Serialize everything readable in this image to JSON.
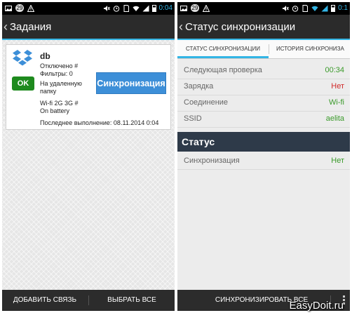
{
  "left": {
    "statusbar": {
      "notif_count": "29",
      "time": "0:04"
    },
    "actionbar": {
      "title": "Задания"
    },
    "card": {
      "name": "db",
      "status_lines": [
        "Отключено #",
        "Фильтры: 0",
        "На удаленную",
        "папку",
        "Wi-fi 2G 3G #",
        "On battery"
      ],
      "last_run": "Последнее выполнение: 08.11.2014 0:04",
      "ok_label": "OK",
      "sync_button": "Синхронизация"
    },
    "bottombar": {
      "add_link": "ДОБАВИТЬ СВЯЗЬ",
      "select_all": "ВЫБРАТЬ ВСЕ"
    }
  },
  "right": {
    "statusbar": {
      "notif_count": "29",
      "time": "0:1"
    },
    "actionbar": {
      "title": "Статус синхронизации"
    },
    "tabs": [
      "СТАТУС СИНХРОНИЗАЦИИ",
      "ИСТОРИЯ СИНХРОНИЗА"
    ],
    "info": [
      {
        "label": "Следующая проверка",
        "value": "00:34",
        "color": "green"
      },
      {
        "label": "Зарядка",
        "value": "Нет",
        "color": "red"
      },
      {
        "label": "Соединение",
        "value": "Wi-fi",
        "color": "green"
      },
      {
        "label": "SSID",
        "value": "aelita",
        "color": "green"
      }
    ],
    "status_header": "Статус",
    "status_rows": [
      {
        "label": "Синхронизация",
        "value": "Нет",
        "color": "green"
      }
    ],
    "bottombar": {
      "sync_all": "СИНХРОНИЗИРОВАТЬ ВСЕ"
    }
  },
  "watermark": "EasyDoit.ru",
  "colors": {
    "accent": "#33b5e5",
    "sync_button": "#3d8fd8",
    "ok_badge": "#1e8a1e",
    "section_header": "#2e3a49"
  },
  "icons": [
    "image-icon",
    "notification-count-badge",
    "warning-icon",
    "mute-icon",
    "alarm-icon",
    "sim-icon",
    "wifi-icon",
    "signal-icon",
    "battery-icon",
    "dropbox-icon",
    "overflow-menu-icon"
  ]
}
